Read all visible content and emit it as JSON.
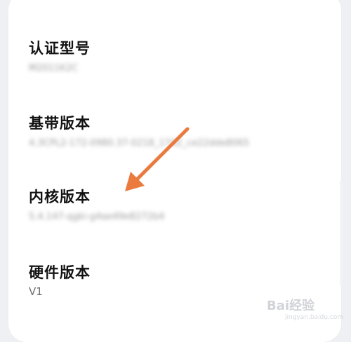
{
  "rows": [
    {
      "title": "认证型号",
      "value": "M2011K2C",
      "blurred": true
    },
    {
      "title": "基带版本",
      "value": "4.3CPL2-172-0980.37-0218_1742_ce22dde8065",
      "blurred": true
    },
    {
      "title": "内核版本",
      "value": "5.4.147-qgki-g4ae49e8272b4",
      "blurred": true
    },
    {
      "title": "硬件版本",
      "value": "V1",
      "blurred": false
    }
  ],
  "watermark": {
    "text": "Bai经验",
    "sub": "jingyan.baidu.com"
  },
  "colors": {
    "arrow": "#ea7a3e",
    "title": "#121212",
    "value": "#8a8a8a",
    "background": "#eef0f3"
  }
}
